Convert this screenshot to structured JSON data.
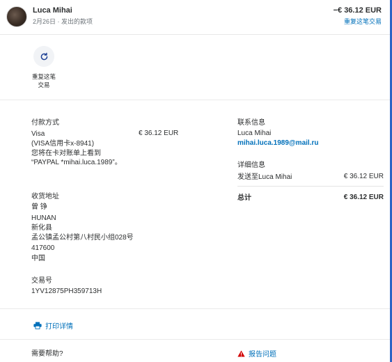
{
  "header": {
    "name": "Luca Mihai",
    "subtitle": "2月26日 · 发出的款项",
    "amount": "−€ 36.12 EUR",
    "repeat_link": "重复这笔交易"
  },
  "repeat_action": {
    "label": "重复这笔交易",
    "icon": "refresh-icon"
  },
  "payment": {
    "title": "付款方式",
    "method": "Visa",
    "card": "(VISA信用卡x-8941)",
    "note": "您将在卡对账单上看到 “PAYPAL *mihai.luca.1989”。",
    "amount": "€ 36.12 EUR"
  },
  "shipping": {
    "title": "收货地址",
    "lines": [
      "曾 铮",
      "HUNAN",
      "新化县",
      "孟公镇孟公村第八村民小组028号",
      "417600",
      "中国"
    ]
  },
  "transaction": {
    "title": "交易号",
    "id": "1YV12875PH359713H"
  },
  "contact": {
    "title": "联系信息",
    "name": "Luca Mihai",
    "email": "mihai.luca.1989@mail.ru"
  },
  "details": {
    "title": "详细信息",
    "sent_to_label": "发送至Luca Mihai",
    "sent_amount": "€ 36.12 EUR",
    "total_label": "总计",
    "total_amount": "€ 36.12 EUR"
  },
  "print": {
    "label": "打印详情"
  },
  "help": {
    "title": "需要帮助?"
  },
  "report": {
    "label": "报告问题"
  },
  "colors": {
    "link": "#0070ba",
    "rail": "#2b63c4",
    "warning": "#d20000"
  }
}
